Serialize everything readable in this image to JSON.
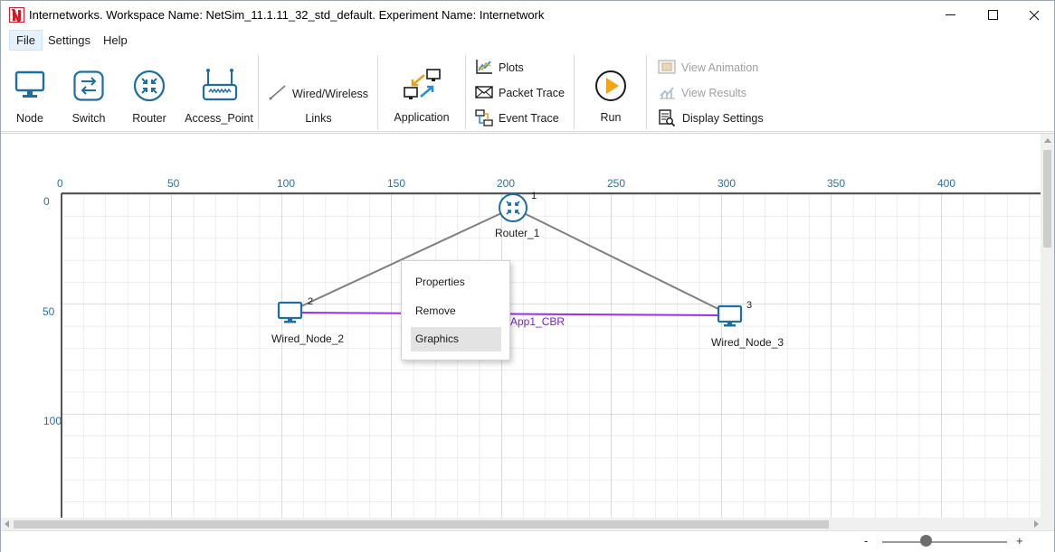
{
  "window": {
    "title": "Internetworks. Workspace Name: NetSim_11.1.11_32_std_default. Experiment Name: Internetwork"
  },
  "menu": {
    "file": "File",
    "settings": "Settings",
    "help": "Help"
  },
  "ribbon": {
    "node": "Node",
    "switch": "Switch",
    "router": "Router",
    "access_point": "Access_Point",
    "wired_wireless": "Wired/Wireless",
    "links": "Links",
    "application": "Application",
    "plots": "Plots",
    "packet_trace": "Packet Trace",
    "event_trace": "Event Trace",
    "run": "Run",
    "view_animation": "View Animation",
    "view_results": "View Results",
    "display_settings": "Display Settings"
  },
  "canvas": {
    "x_ticks": [
      "0",
      "50",
      "100",
      "150",
      "200",
      "250",
      "300",
      "350",
      "400"
    ],
    "y_ticks": [
      "0",
      "50",
      "100"
    ],
    "devices": [
      {
        "name": "Router_1",
        "id": "1",
        "type": "router",
        "x": 204,
        "y": 3
      },
      {
        "name": "Wired_Node_2",
        "id": "2",
        "type": "wired-node",
        "x": 104,
        "y": 50
      },
      {
        "name": "Wired_Node_3",
        "id": "3",
        "type": "wired-node",
        "x": 303,
        "y": 51
      }
    ],
    "application_label": "App1_CBR"
  },
  "context_menu": {
    "items": [
      "Properties",
      "Remove",
      "Graphics"
    ],
    "highlighted": "Graphics"
  },
  "colors": {
    "axis_label": "#2f6f9f",
    "link": "#808080",
    "application": "#7a1fd6",
    "device_blue": "#1c6ea4"
  },
  "statusbar": {
    "zoom_minus": "-",
    "zoom_plus": "+",
    "zoom_level_fraction": 0.35
  }
}
